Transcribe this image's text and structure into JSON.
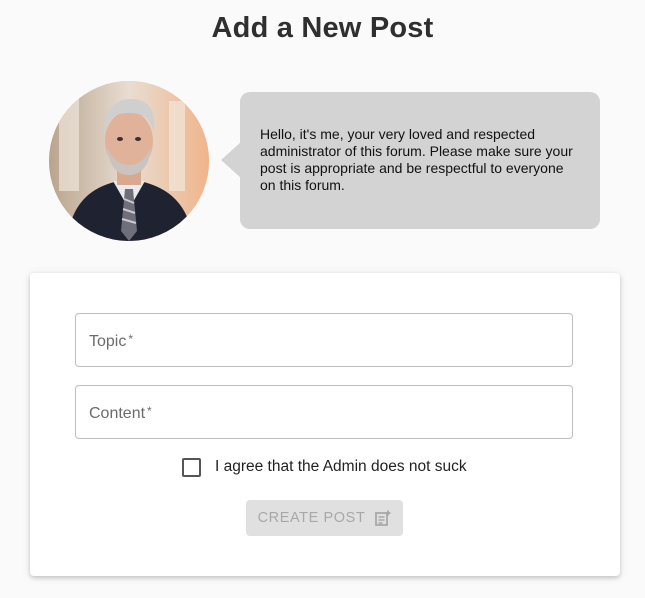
{
  "page": {
    "title": "Add a New Post"
  },
  "admin": {
    "message": "Hello, it's me, your very loved and respected administrator of this forum. Please make sure your post is appropriate and be respectful to everyone on this forum."
  },
  "form": {
    "topic_label": "Topic",
    "content_label": "Content",
    "required_marker": "*",
    "agree_label": "I agree that the Admin does not suck",
    "agree_checked": false,
    "submit_label": "CREATE POST",
    "submit_icon": "post-add-icon",
    "submit_disabled": true
  },
  "colors": {
    "bubble": "#d3d3d3",
    "button_disabled_bg": "#e0e0e0",
    "button_disabled_text": "#a8a8a8"
  }
}
